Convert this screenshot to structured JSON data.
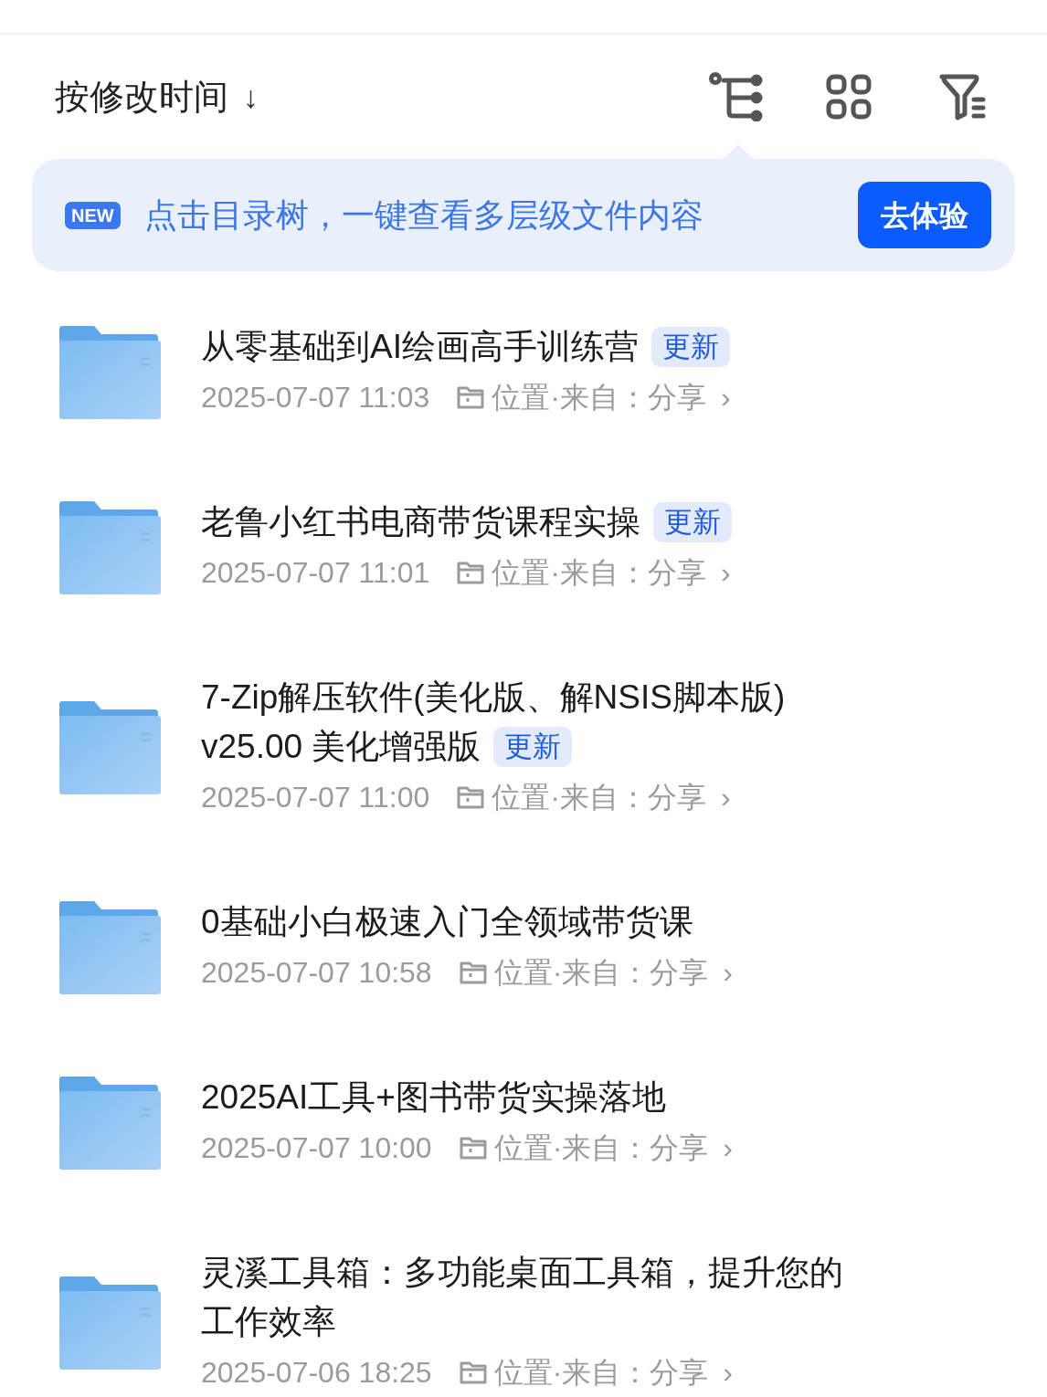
{
  "sort": {
    "label": "按修改时间",
    "arrow": "↓"
  },
  "banner": {
    "badge": "NEW",
    "text": "点击目录树，一键查看多层级文件内容",
    "button": "去体验"
  },
  "files": [
    {
      "name": [
        "从零基础到AI绘画高手训练营"
      ],
      "badge": "更新",
      "time": "2025-07-07 11:03",
      "location": "位置·来自：分享",
      "chevron": "›"
    },
    {
      "name": [
        "老鲁小红书电商带货课程实操"
      ],
      "badge": "更新",
      "time": "2025-07-07 11:01",
      "location": "位置·来自：分享",
      "chevron": "›"
    },
    {
      "name": [
        "7-Zip解压软件(美化版、解NSIS脚本版)",
        "v25.00 美化增强版"
      ],
      "badge": "更新",
      "time": "2025-07-07 11:00",
      "location": "位置·来自：分享",
      "chevron": "›"
    },
    {
      "name": [
        "0基础小白极速入门全领域带货课"
      ],
      "time": "2025-07-07 10:58",
      "location": "位置·来自：分享",
      "chevron": "›"
    },
    {
      "name": [
        "2025AI工具+图书带货实操落地"
      ],
      "time": "2025-07-07 10:00",
      "location": "位置·来自：分享",
      "chevron": "›"
    },
    {
      "name": [
        "灵溪工具箱：多功能桌面工具箱，提升您的",
        "工作效率"
      ],
      "time": "2025-07-06 18:25",
      "location": "位置·来自：分享",
      "chevron": "›"
    }
  ]
}
